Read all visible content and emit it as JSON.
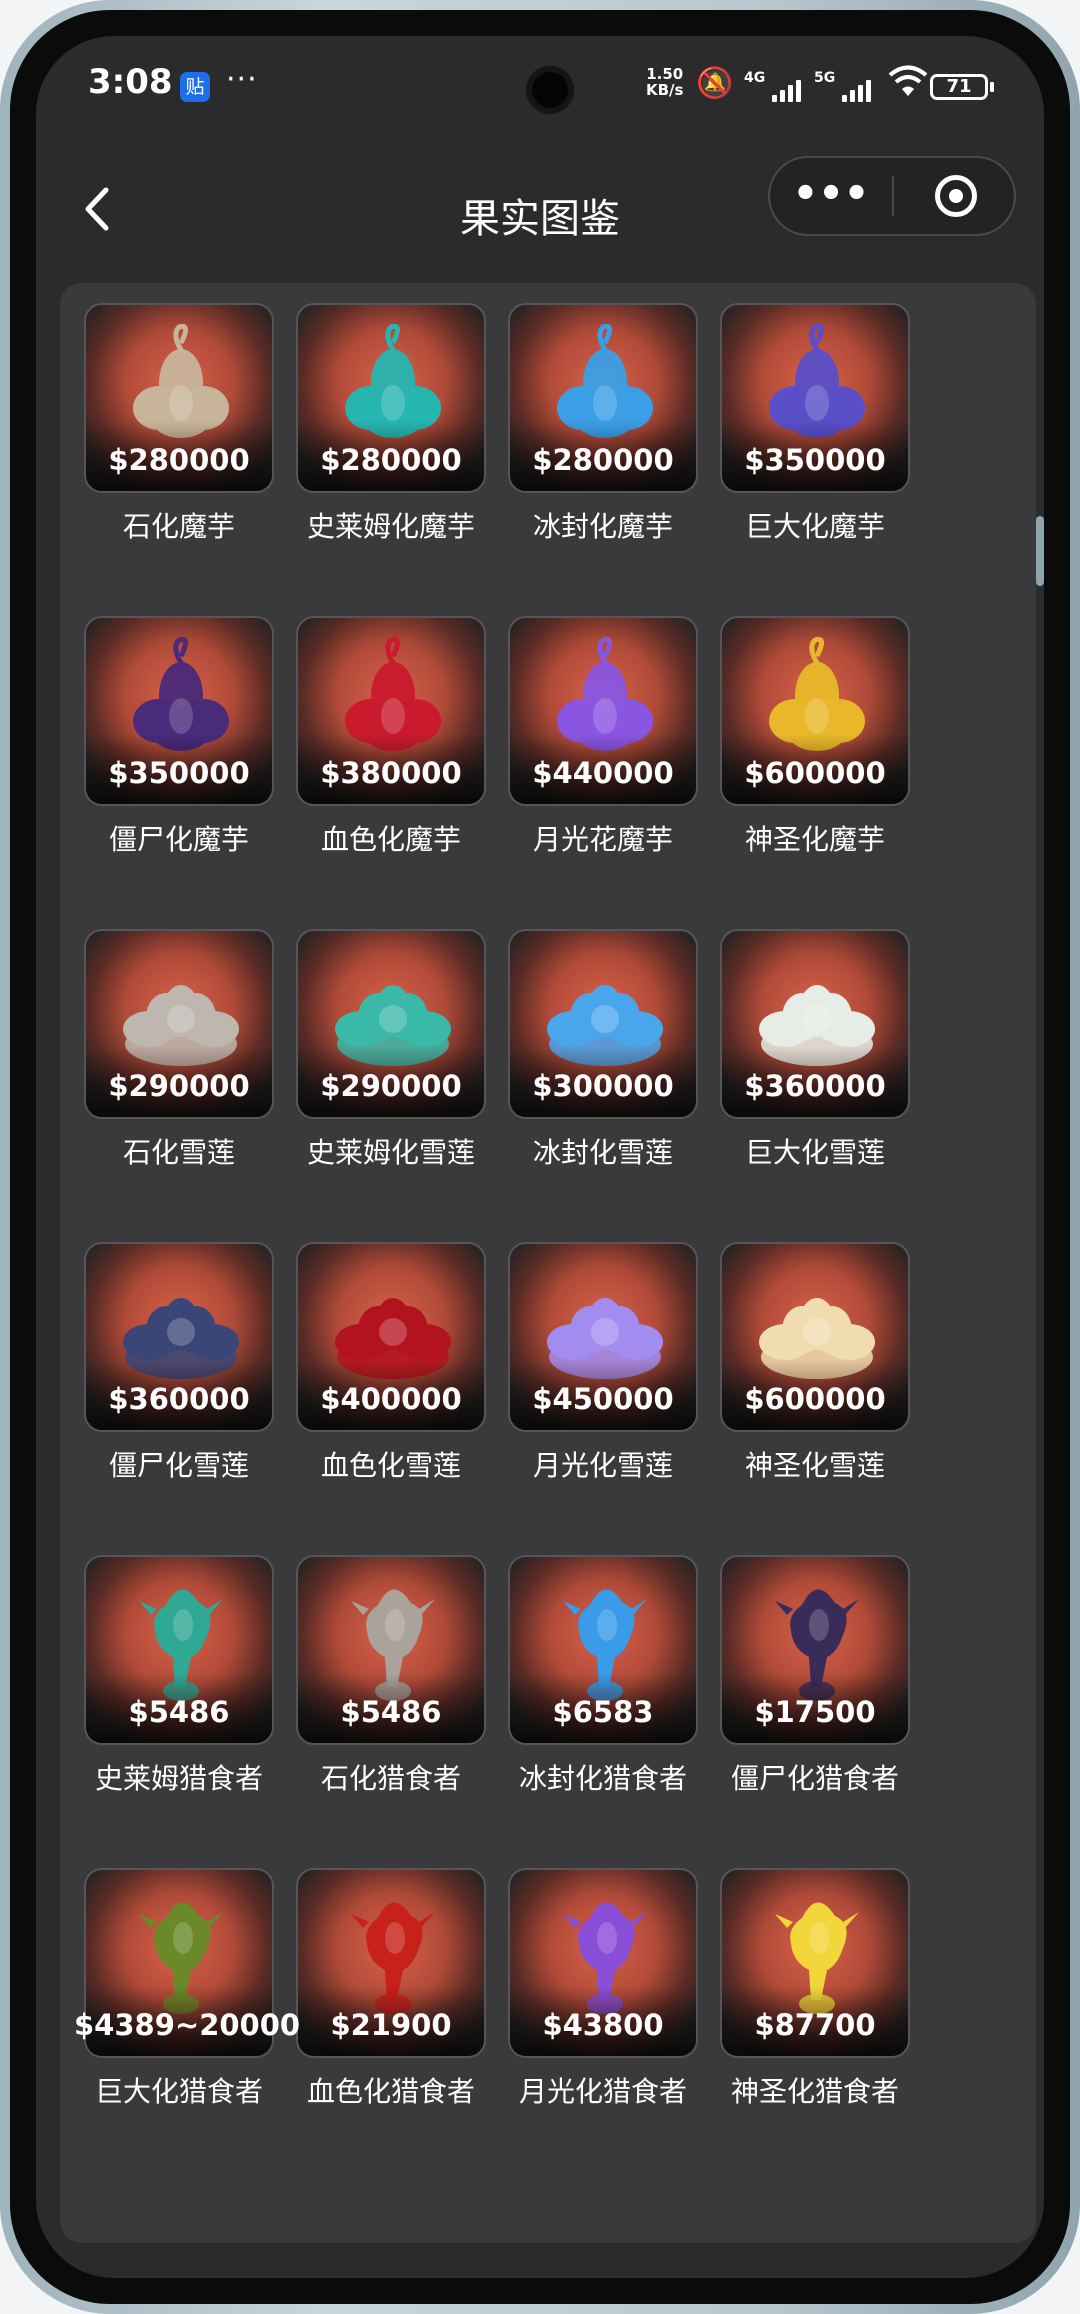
{
  "status_bar": {
    "time": "3:08",
    "app_badge": "贴",
    "more": "···",
    "net_speed_value": "1.50",
    "net_speed_unit": "KB/s",
    "signal_1": "4G",
    "signal_2": "5G",
    "battery": "71"
  },
  "nav": {
    "back_icon": "chevron-left-icon",
    "title": "果实图鉴",
    "capsule_more": "•••",
    "capsule_close_icon": "target-icon"
  },
  "items": [
    {
      "price": "$280000",
      "name": "石化魔芋",
      "kind": "konjac",
      "color": "#c8b49a"
    },
    {
      "price": "$280000",
      "name": "史莱姆化魔芋",
      "kind": "konjac",
      "color": "#27b5b0"
    },
    {
      "price": "$280000",
      "name": "冰封化魔芋",
      "kind": "konjac",
      "color": "#3a9fe6"
    },
    {
      "price": "$350000",
      "name": "巨大化魔芋",
      "kind": "konjac",
      "color": "#5a4fc8"
    },
    {
      "price": "$350000",
      "name": "僵尸化魔芋",
      "kind": "konjac",
      "color": "#4a2a7a"
    },
    {
      "price": "$380000",
      "name": "血色化魔芋",
      "kind": "konjac",
      "color": "#c91a2e"
    },
    {
      "price": "$440000",
      "name": "月光花魔芋",
      "kind": "konjac",
      "color": "#8a55e0"
    },
    {
      "price": "$600000",
      "name": "神圣化魔芋",
      "kind": "konjac",
      "color": "#e8b82a"
    },
    {
      "price": "$290000",
      "name": "石化雪莲",
      "kind": "lotus",
      "color": "#bdb7b0"
    },
    {
      "price": "$290000",
      "name": "史莱姆化雪莲",
      "kind": "lotus",
      "color": "#3ab8a8"
    },
    {
      "price": "$300000",
      "name": "冰封化雪莲",
      "kind": "lotus",
      "color": "#4aa6ec"
    },
    {
      "price": "$360000",
      "name": "巨大化雪莲",
      "kind": "lotus",
      "color": "#e6ece6"
    },
    {
      "price": "$360000",
      "name": "僵尸化雪莲",
      "kind": "lotus",
      "color": "#3a4678"
    },
    {
      "price": "$400000",
      "name": "血色化雪莲",
      "kind": "lotus",
      "color": "#b3121f"
    },
    {
      "price": "$450000",
      "name": "月光化雪莲",
      "kind": "lotus",
      "color": "#a38cf0"
    },
    {
      "price": "$600000",
      "name": "神圣化雪莲",
      "kind": "lotus",
      "color": "#f0dcb0"
    },
    {
      "price": "$5486",
      "name": "史莱姆猎食者",
      "kind": "hunter",
      "color": "#2fa894"
    },
    {
      "price": "$5486",
      "name": "石化猎食者",
      "kind": "hunter",
      "color": "#a9a39c"
    },
    {
      "price": "$6583",
      "name": "冰封化猎食者",
      "kind": "hunter",
      "color": "#3a9be8"
    },
    {
      "price": "$17500",
      "name": "僵尸化猎食者",
      "kind": "hunter",
      "color": "#3a2c5a"
    },
    {
      "price": "$4389~20000",
      "name": "巨大化猎食者",
      "kind": "hunter",
      "color": "#6a8a2a"
    },
    {
      "price": "$21900",
      "name": "血色化猎食者",
      "kind": "hunter",
      "color": "#c8211a"
    },
    {
      "price": "$43800",
      "name": "月光化猎食者",
      "kind": "hunter",
      "color": "#8a4ed8"
    },
    {
      "price": "$87700",
      "name": "神圣化猎食者",
      "kind": "hunter",
      "color": "#f2d63a"
    }
  ]
}
